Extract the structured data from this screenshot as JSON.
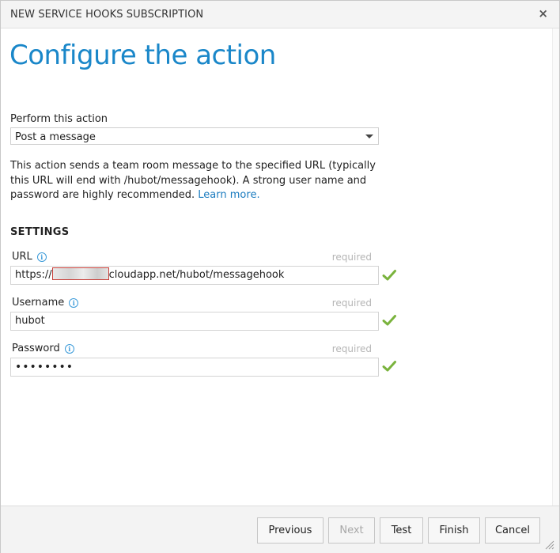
{
  "dialog": {
    "title": "NEW SERVICE HOOKS SUBSCRIPTION",
    "close_glyph": "×"
  },
  "page": {
    "heading": "Configure the action"
  },
  "action": {
    "label": "Perform this action",
    "selected": "Post a message",
    "description": "This action sends a team room message to the specified URL (typically this URL will end with /hubot/messagehook). A strong user name and password are highly recommended.",
    "learn_more": "Learn more."
  },
  "settings": {
    "header": "SETTINGS",
    "required_text": "required",
    "url": {
      "label": "URL",
      "value_prefix": "https://",
      "value_suffix": "cloudapp.net/hubot/messagehook"
    },
    "username": {
      "label": "Username",
      "value": "hubot"
    },
    "password": {
      "label": "Password",
      "value": "••••••••"
    }
  },
  "footer": {
    "previous": "Previous",
    "next": "Next",
    "test": "Test",
    "finish": "Finish",
    "cancel": "Cancel"
  },
  "colors": {
    "accent": "#1a87c9",
    "link": "#1a7bbf",
    "valid_check": "#7ab33d",
    "redaction_border": "#c8403a"
  }
}
